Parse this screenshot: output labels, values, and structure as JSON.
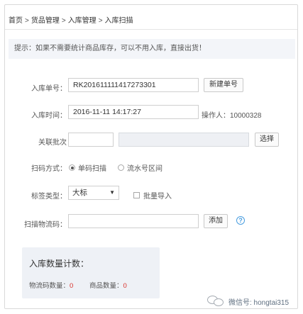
{
  "breadcrumb": {
    "items": [
      "首页",
      "货品管理",
      "入库管理",
      "入库扫描"
    ],
    "separator": ">"
  },
  "tip": {
    "text": "提示：如果不需要统计商品库存，可以不用入库，直接出货！"
  },
  "form": {
    "order_no": {
      "label": "入库单号：",
      "value": "RK201611111417273301",
      "new_button": "新建单号"
    },
    "order_time": {
      "label": "入库时间：",
      "value": "2016-11-11 14:17:27",
      "operator": "操作人：10000328"
    },
    "batch": {
      "label": "关联批次",
      "value": "",
      "select_button": "选择"
    },
    "scan_mode": {
      "label": "扫码方式：",
      "options": [
        "单码扫描",
        "流水号区间"
      ],
      "selected_index": 0
    },
    "label_type": {
      "label": "标签类型：",
      "selected": "大标",
      "caret": "▼",
      "bulk_import": "批量导入"
    },
    "scan_code": {
      "label": "扫描物流码：",
      "value": "",
      "add_button": "添加",
      "help": "?"
    }
  },
  "counts": {
    "title": "入库数量计数：",
    "logistics": {
      "label": "物流码数量：",
      "value": "0"
    },
    "goods": {
      "label": "商品数量：",
      "value": "0"
    }
  },
  "watermark": {
    "text": "微信号: hongtai315"
  },
  "colors": {
    "accent_red": "#d9322c",
    "help_blue": "#4a9ee0",
    "tip_bg": "#f3f5f9",
    "panel_bg": "#eef1f6"
  }
}
